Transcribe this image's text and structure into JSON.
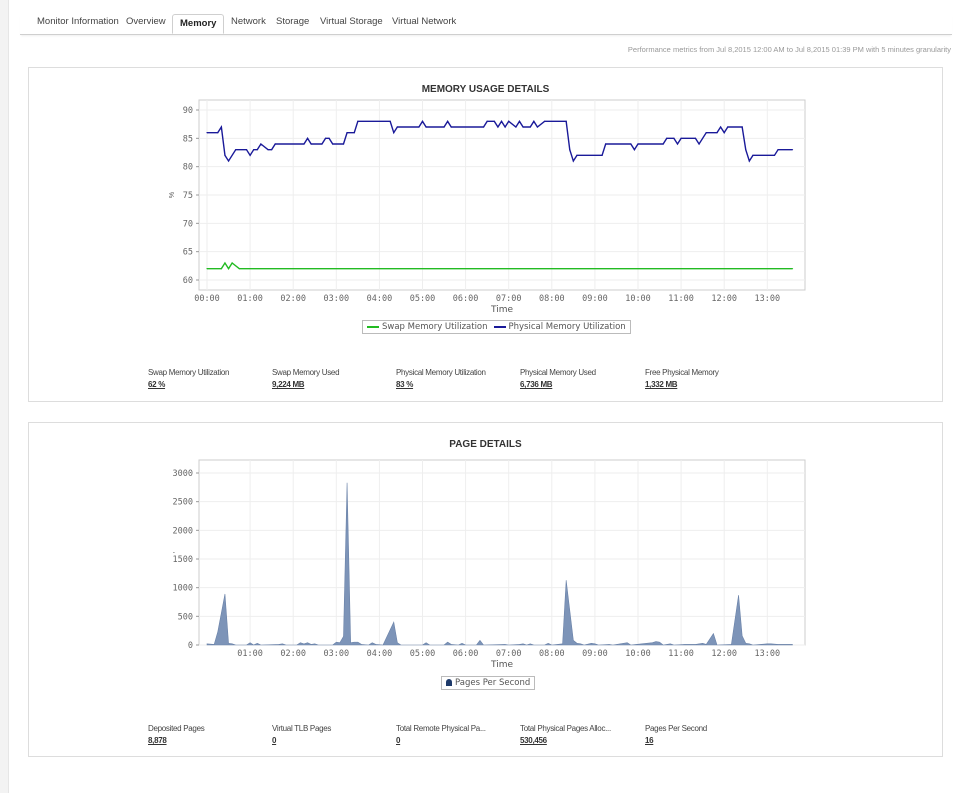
{
  "tabs": [
    {
      "label": "Monitor Information"
    },
    {
      "label": "Overview"
    },
    {
      "label": "Memory",
      "active": true
    },
    {
      "label": "Network"
    },
    {
      "label": "Storage"
    },
    {
      "label": "Virtual Storage"
    },
    {
      "label": "Virtual Network"
    }
  ],
  "performance_note": "Performance metrics from Jul 8,2015 12:00 AM to Jul 8,2015 01:39 PM with 5 minutes granularity",
  "memory_panel": {
    "title": "MEMORY USAGE DETAILS",
    "stats": [
      {
        "label": "Swap Memory Utilization",
        "value": "62 %"
      },
      {
        "label": "Swap Memory Used",
        "value": "9,224 MB"
      },
      {
        "label": "Physical Memory Utilization",
        "value": "83 %"
      },
      {
        "label": "Physical Memory Used",
        "value": "6,736 MB"
      },
      {
        "label": "Free Physical Memory",
        "value": "1,332 MB"
      }
    ]
  },
  "page_panel": {
    "title": "PAGE DETAILS",
    "stats": [
      {
        "label": "Deposited Pages",
        "value": "8,878"
      },
      {
        "label": "Virtual TLB Pages",
        "value": "0"
      },
      {
        "label": "Total Remote Physical Pa...",
        "value": "0"
      },
      {
        "label": "Total Physical Pages Alloc...",
        "value": "530,456"
      },
      {
        "label": "Pages Per Second",
        "value": "16"
      }
    ]
  },
  "chart_data": [
    {
      "type": "line",
      "title": "MEMORY USAGE DETAILS",
      "xlabel": "Time",
      "ylabel": "%",
      "ylim": [
        60,
        90
      ],
      "yticks": [
        60,
        65,
        70,
        75,
        80,
        85,
        90
      ],
      "xticks": [
        "00:00",
        "01:00",
        "02:00",
        "03:00",
        "04:00",
        "05:00",
        "06:00",
        "07:00",
        "08:00",
        "09:00",
        "10:00",
        "11:00",
        "12:00",
        "13:00"
      ],
      "grid": true,
      "legend": "bottom",
      "series": [
        {
          "name": "Swap Memory Utilization",
          "color": "#22bb22",
          "points": [
            [
              "00:00",
              62
            ],
            [
              "00:20",
              62
            ],
            [
              "00:25",
              63
            ],
            [
              "00:30",
              62
            ],
            [
              "00:35",
              63
            ],
            [
              "00:45",
              62
            ],
            [
              "13:35",
              62
            ]
          ]
        },
        {
          "name": "Physical Memory Utilization",
          "color": "#1a1a99",
          "points": [
            [
              "00:00",
              86
            ],
            [
              "00:15",
              86
            ],
            [
              "00:20",
              87
            ],
            [
              "00:25",
              82
            ],
            [
              "00:30",
              81
            ],
            [
              "00:40",
              83
            ],
            [
              "00:55",
              83
            ],
            [
              "01:00",
              82
            ],
            [
              "01:05",
              83
            ],
            [
              "01:10",
              83
            ],
            [
              "01:15",
              84
            ],
            [
              "01:25",
              83
            ],
            [
              "01:30",
              83
            ],
            [
              "01:35",
              84
            ],
            [
              "02:15",
              84
            ],
            [
              "02:20",
              85
            ],
            [
              "02:25",
              84
            ],
            [
              "02:40",
              84
            ],
            [
              "02:45",
              85
            ],
            [
              "02:50",
              85
            ],
            [
              "02:55",
              84
            ],
            [
              "03:10",
              84
            ],
            [
              "03:15",
              86
            ],
            [
              "03:25",
              86
            ],
            [
              "03:30",
              88
            ],
            [
              "04:15",
              88
            ],
            [
              "04:20",
              86
            ],
            [
              "04:25",
              87
            ],
            [
              "04:55",
              87
            ],
            [
              "05:00",
              88
            ],
            [
              "05:05",
              87
            ],
            [
              "05:30",
              87
            ],
            [
              "05:35",
              88
            ],
            [
              "05:40",
              87
            ],
            [
              "06:25",
              87
            ],
            [
              "06:30",
              88
            ],
            [
              "06:40",
              88
            ],
            [
              "06:45",
              87
            ],
            [
              "06:50",
              88
            ],
            [
              "06:55",
              87
            ],
            [
              "07:00",
              88
            ],
            [
              "07:10",
              87
            ],
            [
              "07:15",
              88
            ],
            [
              "07:20",
              87
            ],
            [
              "07:30",
              87
            ],
            [
              "07:35",
              88
            ],
            [
              "07:40",
              87
            ],
            [
              "07:50",
              88
            ],
            [
              "08:20",
              88
            ],
            [
              "08:25",
              83
            ],
            [
              "08:30",
              81
            ],
            [
              "08:35",
              82
            ],
            [
              "09:10",
              82
            ],
            [
              "09:15",
              84
            ],
            [
              "09:50",
              84
            ],
            [
              "09:55",
              83
            ],
            [
              "10:00",
              84
            ],
            [
              "10:35",
              84
            ],
            [
              "10:40",
              85
            ],
            [
              "10:50",
              85
            ],
            [
              "10:55",
              84
            ],
            [
              "11:00",
              85
            ],
            [
              "11:20",
              85
            ],
            [
              "11:25",
              84
            ],
            [
              "11:35",
              86
            ],
            [
              "11:50",
              86
            ],
            [
              "11:55",
              87
            ],
            [
              "12:00",
              86
            ],
            [
              "12:05",
              87
            ],
            [
              "12:25",
              87
            ],
            [
              "12:30",
              83
            ],
            [
              "12:35",
              81
            ],
            [
              "12:40",
              82
            ],
            [
              "13:10",
              82
            ],
            [
              "13:15",
              83
            ],
            [
              "13:35",
              83
            ]
          ]
        }
      ]
    },
    {
      "type": "area",
      "title": "PAGE DETAILS",
      "xlabel": "Time",
      "ylabel": ",",
      "ylim": [
        0,
        3000
      ],
      "yticks": [
        0,
        500,
        1000,
        1500,
        2000,
        2500,
        3000
      ],
      "xticks": [
        "01:00",
        "02:00",
        "03:00",
        "04:00",
        "05:00",
        "06:00",
        "07:00",
        "08:00",
        "09:00",
        "10:00",
        "11:00",
        "12:00",
        "13:00"
      ],
      "grid": true,
      "legend": "bottom",
      "series": [
        {
          "name": "Pages Per Second",
          "color": "#7d94b8",
          "points": [
            [
              "00:00",
              20
            ],
            [
              "00:10",
              10
            ],
            [
              "00:15",
              230
            ],
            [
              "00:25",
              890
            ],
            [
              "00:30",
              30
            ],
            [
              "00:35",
              20
            ],
            [
              "00:40",
              0
            ],
            [
              "00:55",
              0
            ],
            [
              "01:00",
              40
            ],
            [
              "01:05",
              0
            ],
            [
              "01:10",
              30
            ],
            [
              "01:15",
              0
            ],
            [
              "01:40",
              10
            ],
            [
              "01:45",
              20
            ],
            [
              "01:50",
              0
            ],
            [
              "02:05",
              0
            ],
            [
              "02:10",
              40
            ],
            [
              "02:15",
              20
            ],
            [
              "02:20",
              40
            ],
            [
              "02:25",
              10
            ],
            [
              "02:30",
              20
            ],
            [
              "02:35",
              0
            ],
            [
              "02:55",
              0
            ],
            [
              "03:00",
              50
            ],
            [
              "03:05",
              40
            ],
            [
              "03:10",
              150
            ],
            [
              "03:15",
              2830
            ],
            [
              "03:20",
              40
            ],
            [
              "03:25",
              50
            ],
            [
              "03:30",
              50
            ],
            [
              "03:35",
              10
            ],
            [
              "03:45",
              0
            ],
            [
              "03:50",
              40
            ],
            [
              "03:55",
              10
            ],
            [
              "04:05",
              0
            ],
            [
              "04:20",
              400
            ],
            [
              "04:25",
              40
            ],
            [
              "04:30",
              0
            ],
            [
              "05:00",
              0
            ],
            [
              "05:05",
              40
            ],
            [
              "05:10",
              0
            ],
            [
              "05:30",
              0
            ],
            [
              "05:35",
              50
            ],
            [
              "05:40",
              10
            ],
            [
              "05:50",
              0
            ],
            [
              "05:55",
              30
            ],
            [
              "06:00",
              0
            ],
            [
              "06:15",
              0
            ],
            [
              "06:20",
              80
            ],
            [
              "06:25",
              0
            ],
            [
              "06:55",
              10
            ],
            [
              "07:00",
              0
            ],
            [
              "07:15",
              10
            ],
            [
              "07:20",
              20
            ],
            [
              "07:25",
              0
            ],
            [
              "07:30",
              20
            ],
            [
              "07:35",
              0
            ],
            [
              "07:50",
              0
            ],
            [
              "07:55",
              30
            ],
            [
              "08:00",
              0
            ],
            [
              "08:15",
              20
            ],
            [
              "08:20",
              1130
            ],
            [
              "08:30",
              80
            ],
            [
              "08:35",
              30
            ],
            [
              "08:40",
              20
            ],
            [
              "08:45",
              0
            ],
            [
              "08:55",
              30
            ],
            [
              "09:00",
              20
            ],
            [
              "09:05",
              0
            ],
            [
              "09:20",
              10
            ],
            [
              "09:25",
              0
            ],
            [
              "09:45",
              40
            ],
            [
              "09:50",
              0
            ],
            [
              "10:20",
              40
            ],
            [
              "10:25",
              60
            ],
            [
              "10:30",
              50
            ],
            [
              "10:35",
              0
            ],
            [
              "10:45",
              20
            ],
            [
              "10:50",
              0
            ],
            [
              "11:05",
              10
            ],
            [
              "11:20",
              10
            ],
            [
              "11:30",
              30
            ],
            [
              "11:35",
              10
            ],
            [
              "11:45",
              200
            ],
            [
              "11:50",
              0
            ],
            [
              "12:10",
              10
            ],
            [
              "12:20",
              870
            ],
            [
              "12:25",
              160
            ],
            [
              "12:30",
              30
            ],
            [
              "12:35",
              20
            ],
            [
              "12:40",
              0
            ],
            [
              "13:00",
              20
            ],
            [
              "13:05",
              20
            ],
            [
              "13:15",
              10
            ],
            [
              "13:35",
              10
            ]
          ]
        }
      ]
    }
  ]
}
